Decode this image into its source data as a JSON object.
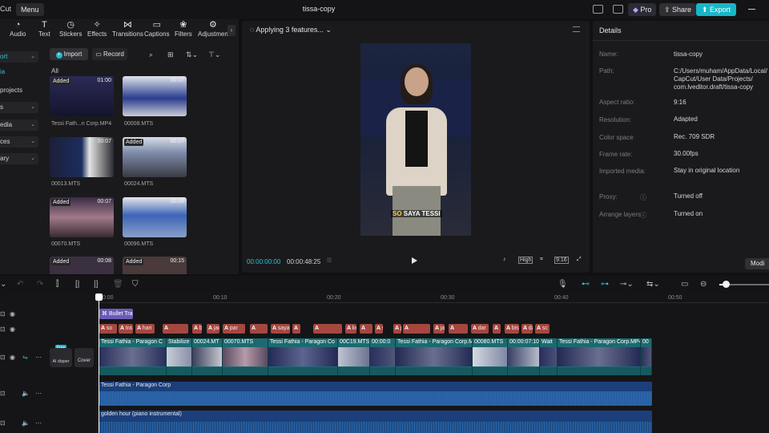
{
  "app": {
    "name": "Cut",
    "menu_label": "Menu",
    "project_title": "tissa-copy"
  },
  "topbar": {
    "pro_label": "Pro",
    "share_label": "Share",
    "export_label": "Export"
  },
  "toolbar": {
    "items": [
      "Audio",
      "Text",
      "Stickers",
      "Effects",
      "Transitions",
      "Captions",
      "Filters",
      "Adjustmen"
    ]
  },
  "leftnav": {
    "items": [
      "ort",
      "ia",
      "projects",
      "s",
      "edia",
      "ces",
      "ary"
    ]
  },
  "media": {
    "import_label": "Import",
    "record_label": "Record",
    "all_label": "All",
    "added_label": "Added",
    "items": [
      {
        "name": "Tessi Fath...n Corp.MP4",
        "duration": "01:00",
        "added": true
      },
      {
        "name": "00008.MTS",
        "duration": "00:07",
        "added": false
      },
      {
        "name": "00013.MTS",
        "duration": "00:07",
        "added": false
      },
      {
        "name": "00024.MTS",
        "duration": "00:07",
        "added": true
      },
      {
        "name": "00070.MTS",
        "duration": "00:07",
        "added": true
      },
      {
        "name": "00096.MTS",
        "duration": "00:06",
        "added": false
      },
      {
        "name": "",
        "duration": "00:08",
        "added": true
      },
      {
        "name": "",
        "duration": "00:15",
        "added": true
      }
    ]
  },
  "player": {
    "status": "Applying 3 features...",
    "caption_highlight": "SO",
    "caption_rest": " SAYA TESSI",
    "time_current": "00:00:00:00",
    "time_total": "00:00:48:25",
    "quality": "High",
    "ratio": "9:16"
  },
  "details": {
    "title": "Details",
    "rows": [
      {
        "label": "Name:",
        "value": "tissa-copy"
      },
      {
        "label": "Path:",
        "value": "C:/Users/muham/AppData/Local/\nCapCut/User Data/Projects/\ncom.lveditor.draft/tissa-copy"
      },
      {
        "label": "Aspect ratio:",
        "value": "9:16"
      },
      {
        "label": "Resolution:",
        "value": "Adapted"
      },
      {
        "label": "Color space",
        "value": "Rec. 709 SDR"
      },
      {
        "label": "Frame rate:",
        "value": "30.00fps"
      },
      {
        "label": "Imported media:",
        "value": "Stay in original location"
      },
      {
        "label": "Proxy:",
        "value": "Turned off"
      },
      {
        "label": "Arrange layers",
        "value": "Turned on"
      }
    ],
    "modify_label": "Modi"
  },
  "timeline": {
    "ruler": [
      "00:00",
      "00:10",
      "00:20",
      "00:30",
      "00:40",
      "00:50"
    ],
    "bullet_clip": "Bullet Tra",
    "text_clips": [
      "so",
      "tra",
      "hari",
      "",
      "bag",
      "jad",
      "par",
      "",
      "saya",
      "",
      "",
      "kemu",
      "",
      "sa",
      "pes",
      "",
      "ja",
      "",
      "dar",
      "",
      "bis",
      "da",
      "sc"
    ],
    "video_segments": [
      "Tessi Fathia - Paragon C",
      "Stabilize",
      "00024.MT",
      "00070.MTS",
      "Tessi Fathia - Paragon Co",
      "00C19.MTS",
      "00:00:0",
      "Tessi Fathia - Paragon Corp.M",
      "00080.MTS",
      "00:00:07:10",
      "Wait",
      "Tessi Fathia - Paragon Corp.MP4",
      "00"
    ],
    "free_badge": "Free",
    "clipper_label": "AI clipper",
    "cover_label": "Cover",
    "audio1": "Tessi Fathia - Paragon Corp",
    "audio2": "golden hour (piano instrumental)"
  }
}
